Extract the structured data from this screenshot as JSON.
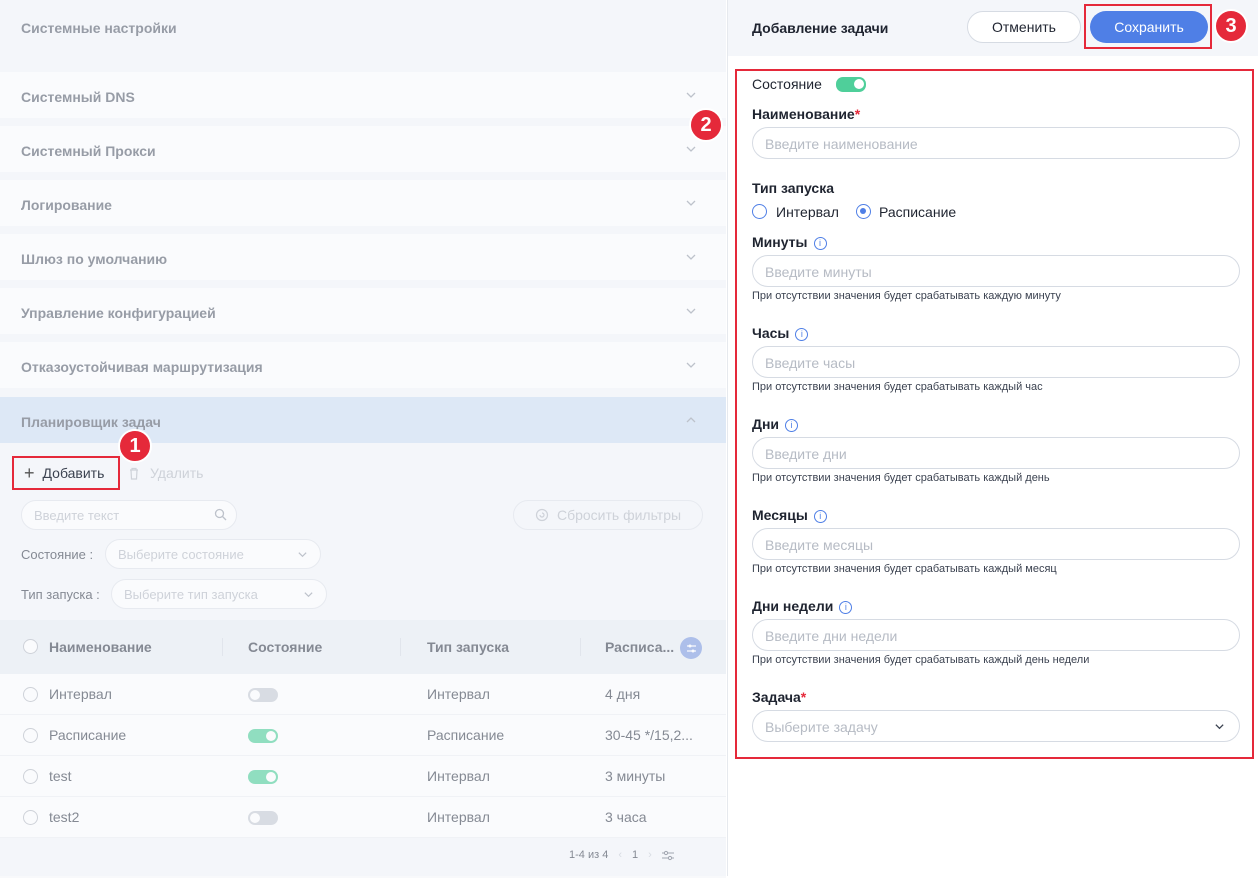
{
  "left": {
    "title": "Системные настройки",
    "sections": [
      {
        "label": "Системный DNS"
      },
      {
        "label": "Системный Прокси"
      },
      {
        "label": "Логирование"
      },
      {
        "label": "Шлюз по умолчанию"
      },
      {
        "label": "Управление конфигурацией"
      },
      {
        "label": "Отказоустойчивая маршрутизация"
      },
      {
        "label": "Планировщик задач"
      }
    ],
    "toolbar": {
      "add_label": "Добавить",
      "delete_label": "Удалить"
    },
    "search": {
      "placeholder": "Введите текст"
    },
    "reset_label": "Сбросить фильтры",
    "filters": {
      "state_label": "Состояние :",
      "state_placeholder": "Выберите состояние",
      "launch_label": "Тип запуска :",
      "launch_placeholder": "Выберите тип запуска"
    },
    "table": {
      "columns": [
        "Наименование",
        "Состояние",
        "Тип запуска",
        "Расписа..."
      ],
      "rows": [
        {
          "name": "Интервал",
          "enabled": false,
          "type": "Интервал",
          "schedule": "4 дня"
        },
        {
          "name": "Расписание",
          "enabled": true,
          "type": "Расписание",
          "schedule": "30-45 */15,2..."
        },
        {
          "name": "test",
          "enabled": true,
          "type": "Интервал",
          "schedule": "3 минуты"
        },
        {
          "name": "test2",
          "enabled": false,
          "type": "Интервал",
          "schedule": "3 часа"
        }
      ]
    },
    "pagination": {
      "range": "1-4 из 4",
      "page": "1"
    }
  },
  "markers": [
    "1",
    "2",
    "3"
  ],
  "panel": {
    "title": "Добавление задачи",
    "cancel_label": "Отменить",
    "save_label": "Сохранить",
    "state_label": "Состояние",
    "name_label": "Наименование",
    "name_placeholder": "Введите наименование",
    "launch_label": "Тип запуска",
    "launch_options": [
      "Интервал",
      "Расписание"
    ],
    "launch_selected": "Расписание",
    "minutes": {
      "label": "Минуты",
      "placeholder": "Введите минуты",
      "hint": "При отсутствии значения будет срабатывать каждую минуту"
    },
    "hours": {
      "label": "Часы",
      "placeholder": "Введите часы",
      "hint": "При отсутствии значения будет срабатывать каждый час"
    },
    "days": {
      "label": "Дни",
      "placeholder": "Введите дни",
      "hint": "При отсутствии значения будет срабатывать каждый день"
    },
    "months": {
      "label": "Месяцы",
      "placeholder": "Введите месяцы",
      "hint": "При отсутствии значения будет срабатывать каждый месяц"
    },
    "weekdays": {
      "label": "Дни недели",
      "placeholder": "Введите дни недели",
      "hint": "При отсутствии значения будет срабатывать каждый день недели"
    },
    "task_label": "Задача",
    "task_placeholder": "Выберите задачу",
    "required_mark": "*"
  },
  "colors": {
    "accent": "#4f7fe6",
    "toggle_on": "#4fcf9a",
    "highlight": "#e5293a"
  }
}
